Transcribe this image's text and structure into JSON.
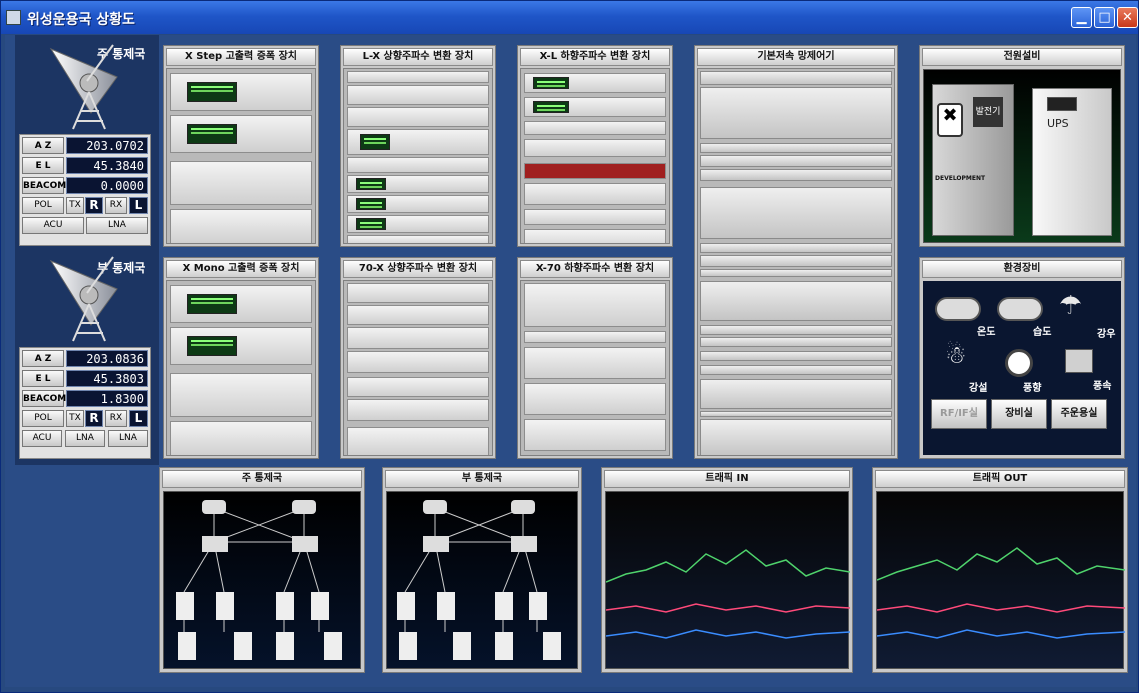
{
  "window": {
    "title": "위성운용국 상황도"
  },
  "left": {
    "main_site": {
      "title": "주 통제국",
      "az": "203.0702",
      "el": "45.3840",
      "beacon": "0.0000"
    },
    "sub_site": {
      "title": "부 통제국",
      "az": "203.0836",
      "el": "45.3803",
      "beacon": "1.8300"
    },
    "labels": {
      "az": "A Z",
      "el": "E L",
      "beacon": "BEACOM",
      "pol": "POL",
      "tx": "TX",
      "r": "R",
      "rx": "RX",
      "l": "L",
      "acu": "ACU",
      "lna": "LNA"
    }
  },
  "panels": {
    "x_step": "X Step 고출력 증폭 장치",
    "lx_up": "L-X 상향주파수 변환 장치",
    "xl_down": "X-L 하향주파수 변환 장치",
    "baseband": "기본저속 망제어기",
    "power": "전원설비",
    "x_mono": "X Mono 고출력 증폭 장치",
    "x70_up": "70-X 상향주파수 변환 장치",
    "x70_down": "X-70 하향주파수 변환 장치",
    "env": "환경장비",
    "net_main": "주 통제국",
    "net_sub": "부 통제국",
    "traffic_in": "트래픽 IN",
    "traffic_out": "트래픽 OUT"
  },
  "power": {
    "dev_label": "DEVELOPMENT",
    "ups": "UPS",
    "gen": "발전기"
  },
  "env": {
    "labels": {
      "temp": "온도",
      "humid": "습도",
      "rain": "강우",
      "snow": "강설",
      "wind_dir": "풍향",
      "wind_speed": "풍속"
    },
    "buttons": {
      "rfif": "RF/IF실",
      "equip": "장비실",
      "ops": "주운용실"
    }
  }
}
